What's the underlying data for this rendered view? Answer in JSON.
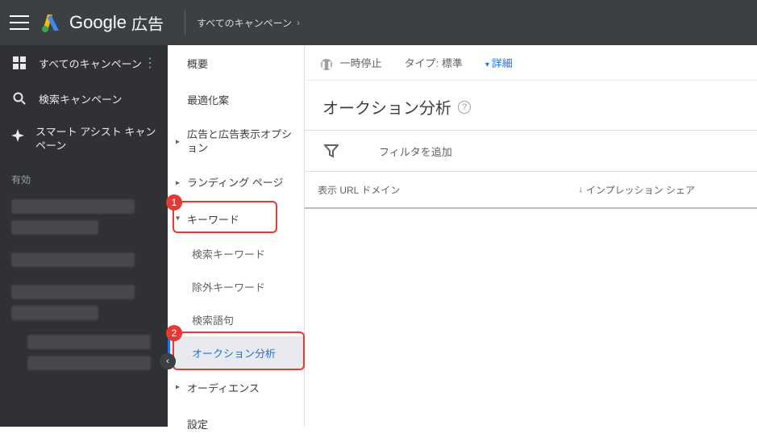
{
  "header": {
    "product_name": "Google",
    "product_suffix": "広告",
    "breadcrumb": "すべてのキャンペーン"
  },
  "sidebar": {
    "items": [
      {
        "label": "すべてのキャンペーン",
        "icon": "grid"
      },
      {
        "label": "検索キャンペーン",
        "icon": "search"
      },
      {
        "label": "スマート アシスト キャンペーン",
        "icon": "sparkle"
      }
    ],
    "section_label": "有効"
  },
  "secnav": {
    "items": [
      {
        "label": "概要",
        "kind": "plain"
      },
      {
        "label": "最適化案",
        "kind": "plain"
      },
      {
        "label": "広告と広告表示オプション",
        "kind": "expandable"
      },
      {
        "label": "ランディング ページ",
        "kind": "expandable"
      },
      {
        "label": "キーワード",
        "kind": "expanded",
        "annot": 1,
        "children": [
          {
            "label": "検索キーワード"
          },
          {
            "label": "除外キーワード"
          },
          {
            "label": "検索語句"
          },
          {
            "label": "オークション分析",
            "active": true,
            "annot": 2
          }
        ]
      },
      {
        "label": "オーディエンス",
        "kind": "expandable"
      },
      {
        "label": "設定",
        "kind": "plain"
      }
    ]
  },
  "statusbar": {
    "paused_label": "一時停止",
    "type_label": "タイプ:",
    "type_value": "標準",
    "details_label": "詳細"
  },
  "main": {
    "page_title": "オークション分析",
    "filter_placeholder": "フィルタを追加",
    "table_headers": {
      "domain": "表示 URL ドメイン",
      "impression_share": "インプレッション シェア"
    }
  },
  "annotations": {
    "1": "1",
    "2": "2"
  }
}
